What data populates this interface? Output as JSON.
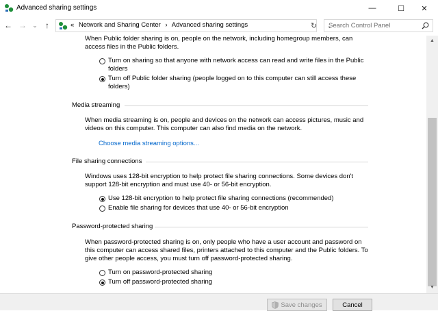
{
  "window": {
    "title": "Advanced sharing settings",
    "minimize": "—",
    "maximize": "☐",
    "close": "✕"
  },
  "nav": {
    "back": "←",
    "forward": "→",
    "recent": "⌄",
    "up": "↑"
  },
  "address": {
    "overflow": "«",
    "crumb1": "Network and Sharing Center",
    "sep": "›",
    "crumb2": "Advanced sharing settings",
    "dropdown": "⌄",
    "refresh": "↻"
  },
  "search": {
    "placeholder": "Search Control Panel"
  },
  "public_folder": {
    "desc1": "When Public folder sharing is on, people on the network, including homegroup members, can",
    "desc2": "access files in the Public folders.",
    "opt_on_1": "Turn on sharing so that anyone with network access can read and write files in the Public",
    "opt_on_2": "folders",
    "opt_off_1": "Turn off Public folder sharing (people logged on to this computer can still access these",
    "opt_off_2": "folders)",
    "selected": "off"
  },
  "media_streaming": {
    "heading": "Media streaming",
    "desc1": "When media streaming is on, people and devices on the network can access pictures, music and",
    "desc2": "videos on this computer. This computer can also find media on the network.",
    "link": "Choose media streaming options..."
  },
  "file_sharing": {
    "heading": "File sharing connections",
    "desc1": "Windows uses 128-bit encryption to help protect file sharing connections. Some devices don't",
    "desc2": "support 128-bit encryption and must use 40- or 56-bit encryption.",
    "opt_128": "Use 128-bit encryption to help protect file sharing connections (recommended)",
    "opt_40": "Enable file sharing for devices that use 40- or 56-bit encryption",
    "selected": "128"
  },
  "password_sharing": {
    "heading": "Password-protected sharing",
    "desc1": "When password-protected sharing is on, only people who have a user account and password on",
    "desc2": "this computer can access shared files, printers attached to this computer and the Public folders. To",
    "desc3": "give other people access, you must turn off password-protected sharing.",
    "opt_on": "Turn on password-protected sharing",
    "opt_off": "Turn off password-protected sharing",
    "selected": "off"
  },
  "footer": {
    "save_label": "Save changes",
    "cancel_label": "Cancel"
  },
  "scrollbar": {
    "up": "▲",
    "down": "▼"
  }
}
